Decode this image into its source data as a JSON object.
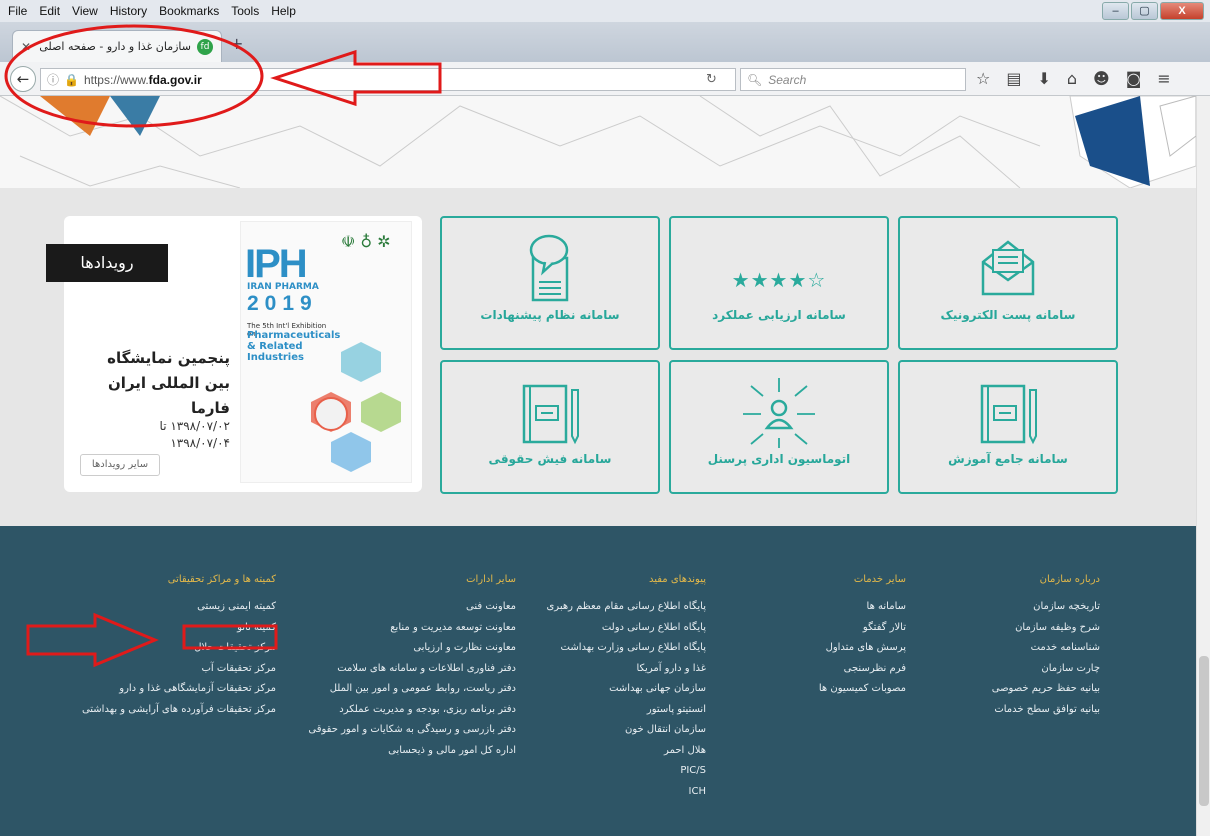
{
  "browser": {
    "menu": [
      "File",
      "Edit",
      "View",
      "History",
      "Bookmarks",
      "Tools",
      "Help"
    ],
    "window_buttons": [
      "–",
      "▢",
      "X"
    ],
    "tab_title": "سازمان غذا و دارو - صفحه اصلی",
    "url_prefix": "https://www.",
    "url_domain": "fda.gov.ir",
    "search_placeholder": "Search"
  },
  "events": {
    "section_label": "رویدادها",
    "title": "پنجمین نمایشگاه بین المللی ایران فارما",
    "date_from": "۱۳۹۸/۰۷/۰۲ تا",
    "date_to": "۱۳۹۸/۰۷/۰۴",
    "more_button": "سایر رویدادها",
    "poster": {
      "logo": "IPH",
      "name": "IRAN PHARMA",
      "year": "2019",
      "subtitle": "The 5th Int'l Exhibition on",
      "subtitle2": "Pharmaceuticals & Related Industries"
    }
  },
  "tiles": [
    {
      "label": "سامانه پست الکترونیک",
      "icon": "envelope-icon"
    },
    {
      "label": "سامانه ارزیابی عملکرد",
      "icon": "stars-rating-icon"
    },
    {
      "label": "سامانه نظام پیشنهادات",
      "icon": "document-speech-icon"
    },
    {
      "label": "سامانه جامع آموزش",
      "icon": "book-icon"
    },
    {
      "label": "اتوماسیون اداری پرسنل",
      "icon": "person-network-icon"
    },
    {
      "label": "سامانه فیش حقوقی",
      "icon": "notebook-icon"
    }
  ],
  "rating": {
    "stars_filled": 4,
    "stars_total": 5
  },
  "footer": {
    "col1": {
      "heading": "درباره سازمان",
      "items": [
        "تاریخچه سازمان",
        "شرح وظیفه سازمان",
        "شناسنامه خدمت",
        "چارت سازمان",
        "بیانیه حفظ حریم خصوصی",
        "بیانیه توافق سطح خدمات"
      ]
    },
    "col2": {
      "heading": "سایر خدمات",
      "items": [
        "سامانه ها",
        "تالار گفتگو",
        "پرسش های متداول",
        "فرم نظرسنجی",
        "مصوبات کمیسیون ها"
      ]
    },
    "col3": {
      "heading": "پیوندهای مفید",
      "items": [
        "پایگاه اطلاع رسانی مقام معظم رهبری",
        "پایگاه اطلاع رسانی دولت",
        "پایگاه اطلاع رسانی وزارت بهداشت",
        "غذا و دارو آمریکا",
        "سازمان جهانی بهداشت",
        "انستیتو پاستور",
        "سازمان انتقال خون",
        "هلال احمر",
        "PIC/S",
        "ICH"
      ]
    },
    "col4": {
      "heading": "سایر ادارات",
      "items": [
        "معاونت فنی",
        "معاونت توسعه مدیریت و منابع",
        "معاونت نظارت و ارزیابی",
        "دفتر فناوری اطلاعات و سامانه های سلامت",
        "دفتر ریاست، روابط عمومی و امور بین الملل",
        "دفتر برنامه ریزی، بودجه و مدیریت عملکرد",
        "دفتر بازرسی و رسیدگی به شکایات و امور حقوقی",
        "اداره کل امور مالی و ذیحسابی"
      ]
    },
    "col5": {
      "heading": "کمیته ها و مراکز تحقیقاتی",
      "items": [
        "کمیته ایمنی زیستی",
        "کمیته نانو",
        "مرکز تحقیقات حلال",
        "مرکز تحقیقات آب",
        "مرکز تحقیقات آزمایشگاهی غذا و دارو",
        "مرکز تحقیقات فرآورده های آرایشی و بهداشتی"
      ]
    }
  }
}
